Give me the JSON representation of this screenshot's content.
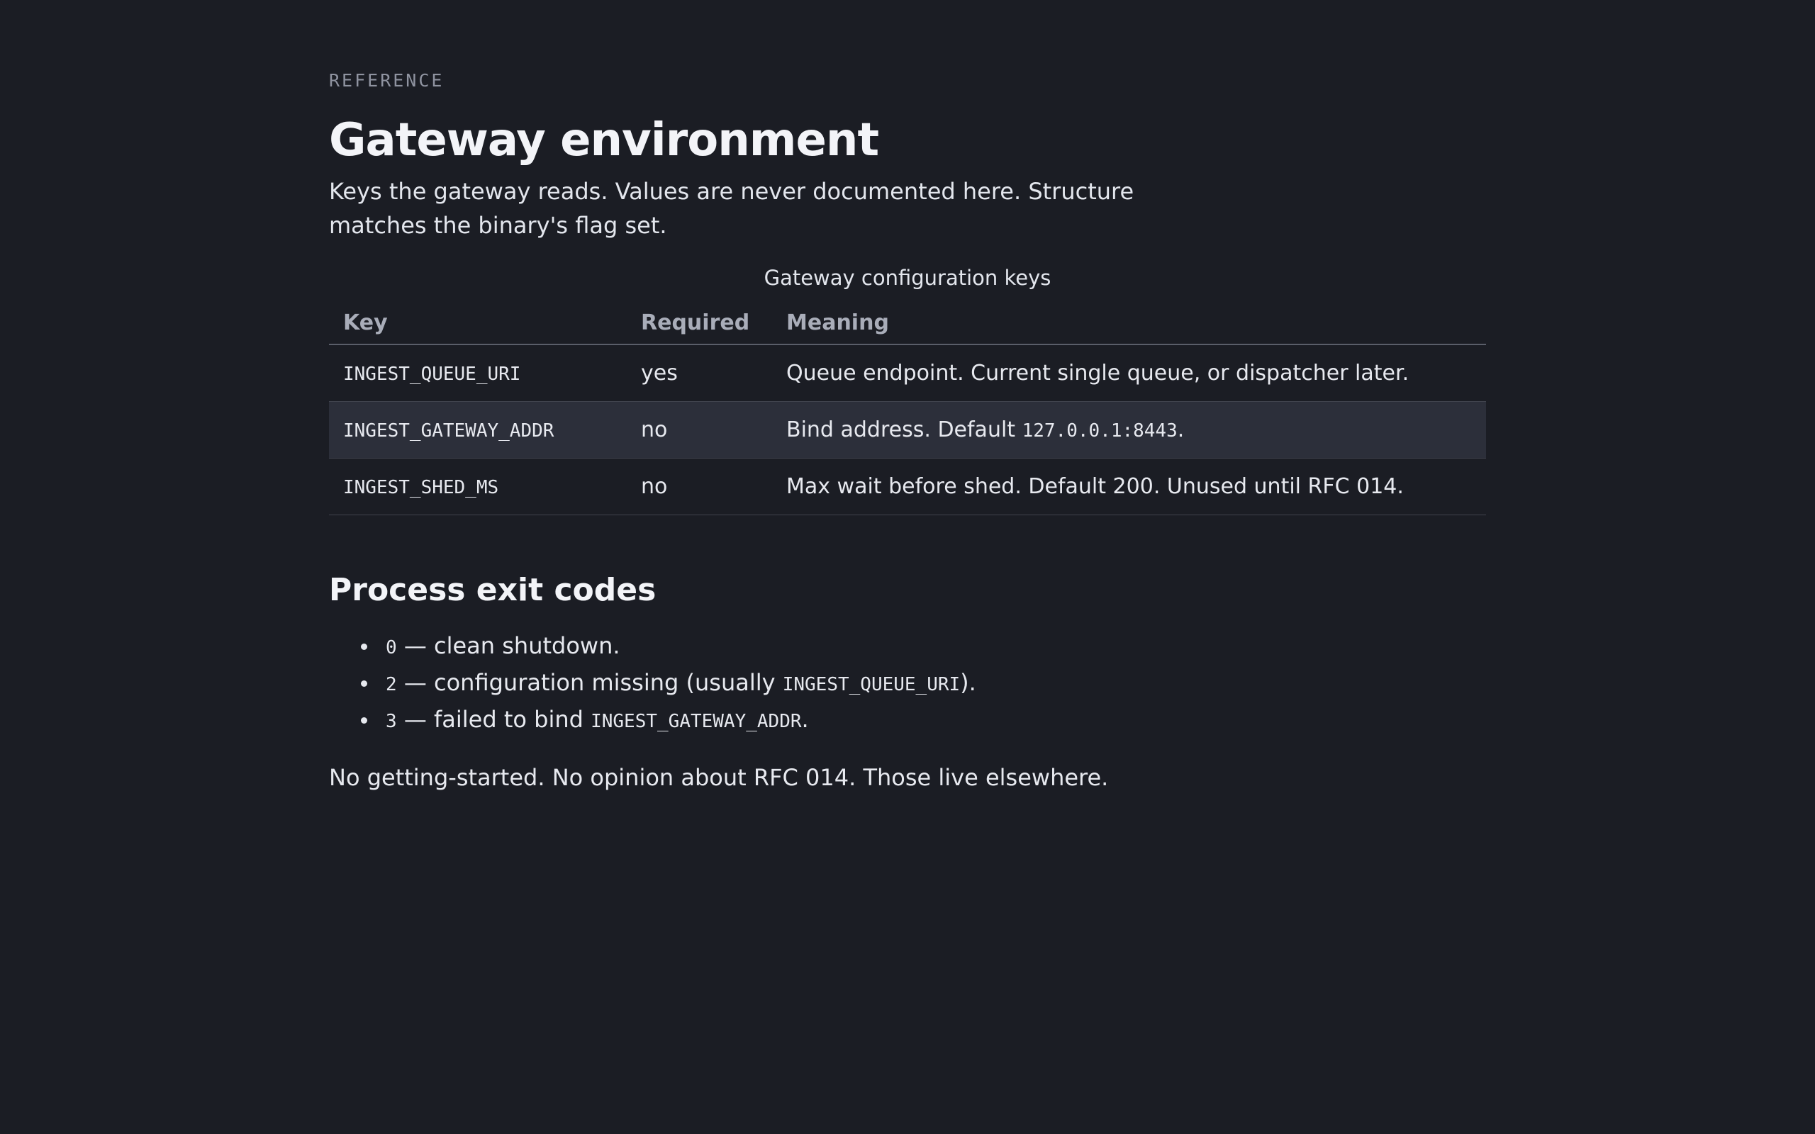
{
  "header": {
    "eyebrow": "REFERENCE",
    "title": "Gateway environment",
    "lede": "Keys the gateway reads. Values are never documented here. Structure matches the binary's flag set."
  },
  "table": {
    "caption": "Gateway configuration keys",
    "columns": [
      "Key",
      "Required",
      "Meaning"
    ],
    "rows": [
      {
        "key": "INGEST_QUEUE_URI",
        "required": "yes",
        "meaning": "Queue endpoint. Current single queue, or dispatcher later.",
        "meaning_code": "",
        "meaning_suffix": ""
      },
      {
        "key": "INGEST_GATEWAY_ADDR",
        "required": "no",
        "meaning": "Bind address. Default ",
        "meaning_code": "127.0.0.1:8443",
        "meaning_suffix": "."
      },
      {
        "key": "INGEST_SHED_MS",
        "required": "no",
        "meaning": "Max wait before shed. Default 200. Unused until RFC 014.",
        "meaning_code": "",
        "meaning_suffix": ""
      }
    ]
  },
  "exit_codes": {
    "heading": "Process exit codes",
    "items": [
      {
        "code": "0",
        "text": " — clean shutdown.",
        "ref": "",
        "suffix": ""
      },
      {
        "code": "2",
        "text": " — configuration missing (usually ",
        "ref": "INGEST_QUEUE_URI",
        "suffix": ")."
      },
      {
        "code": "3",
        "text": " — failed to bind ",
        "ref": "INGEST_GATEWAY_ADDR",
        "suffix": "."
      }
    ]
  },
  "closing": "No getting-started. No opinion about RFC 014. Those live elsewhere."
}
